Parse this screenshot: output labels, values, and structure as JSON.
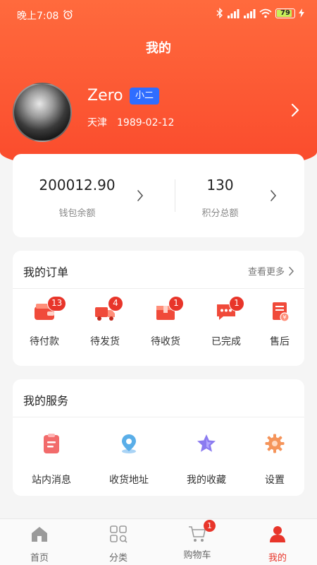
{
  "status_bar": {
    "time": "晚上7:08",
    "battery": "79"
  },
  "header": {
    "title": "我的"
  },
  "profile": {
    "name": "Zero",
    "role": "小二",
    "city": "天津",
    "birthday": "1989-02-12"
  },
  "wallet": {
    "balance_value": "200012.90",
    "balance_label": "钱包余额",
    "points_value": "130",
    "points_label": "积分总额"
  },
  "orders": {
    "title": "我的订单",
    "more": "查看更多",
    "items": [
      {
        "label": "待付款",
        "badge": "13",
        "icon": "wallet-icon"
      },
      {
        "label": "待发货",
        "badge": "4",
        "icon": "truck-icon"
      },
      {
        "label": "待收货",
        "badge": "1",
        "icon": "box-icon"
      },
      {
        "label": "已完成",
        "badge": "1",
        "icon": "message-icon"
      },
      {
        "label": "售后",
        "badge": "",
        "icon": "receipt-icon"
      }
    ]
  },
  "services": {
    "title": "我的服务",
    "items": [
      {
        "label": "站内消息",
        "icon": "clipboard-icon"
      },
      {
        "label": "收货地址",
        "icon": "location-pin-icon"
      },
      {
        "label": "我的收藏",
        "icon": "star-icon"
      },
      {
        "label": "设置",
        "icon": "gear-icon"
      }
    ]
  },
  "tabbar": {
    "items": [
      {
        "label": "首页",
        "icon": "home-icon"
      },
      {
        "label": "分类",
        "icon": "category-icon"
      },
      {
        "label": "购物车",
        "icon": "cart-icon",
        "badge": "1"
      },
      {
        "label": "我的",
        "icon": "user-icon",
        "active": true
      }
    ]
  },
  "colors": {
    "brand": "#fa4a2c",
    "badge": "#e8352a",
    "role_badge": "#2f6dff"
  }
}
